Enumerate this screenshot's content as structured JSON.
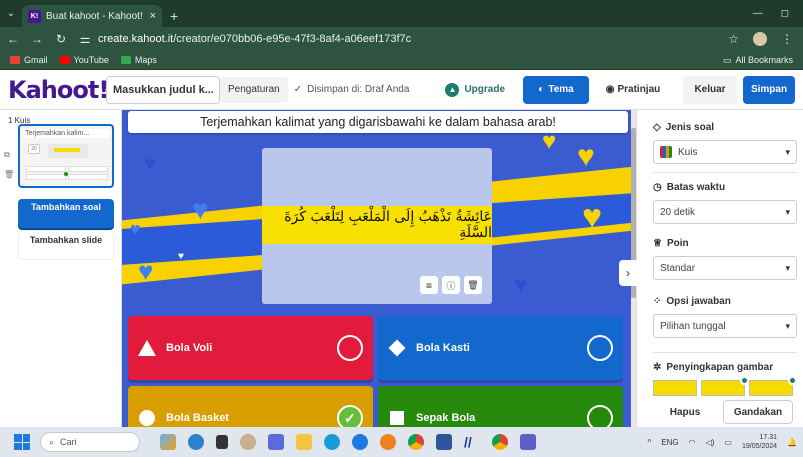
{
  "browser": {
    "tab_title": "Buat kahoot - Kahoot!",
    "tab_favicon": "K!",
    "url_host": "create.kahoot.it",
    "url_path": "/creator/e070bb06-e95e-47f3-8af4-a06eef173f7c",
    "bookmarks": [
      "Gmail",
      "YouTube",
      "Maps"
    ],
    "all_bookmarks": "All Bookmarks"
  },
  "header": {
    "logo": "Kahoot!",
    "title_placeholder": "Masukkan judul k...",
    "settings_label": "Pengaturan",
    "saved_text": "Disimpan di: Draf Anda",
    "upgrade_label": "Upgrade",
    "theme_label": "Tema",
    "preview_label": "Pratinjau",
    "exit_label": "Keluar",
    "save_label": "Simpan"
  },
  "sidebar": {
    "slide_number_label": "1 Kuis",
    "thumb_text": "Terjemahkan kalim...",
    "thumb_timer": "20",
    "add_question": "Tambahkan soal",
    "add_slide": "Tambahkan slide"
  },
  "question": {
    "text": "Terjemahkan kalimat yang digarisbawahi ke dalam bahasa arab!",
    "image_text": "عَائِشَةُ تَذْهَبُ إِلَى الْمَلْعَبِ لِتَلْعَبَ كُرَةَ السَّلَةِ"
  },
  "answers": [
    {
      "label": "Bola Voli",
      "shape": "triangle",
      "color": "#e21b3c",
      "correct": false
    },
    {
      "label": "Bola Kasti",
      "shape": "diamond",
      "color": "#1368ce",
      "correct": false
    },
    {
      "label": "Bola Basket",
      "shape": "circle",
      "color": "#d89e00",
      "correct": true
    },
    {
      "label": "Sepak Bola",
      "shape": "square",
      "color": "#26890c",
      "correct": false
    }
  ],
  "settings_panel": {
    "question_type_label": "Jenis soal",
    "question_type_value": "Kuis",
    "time_limit_label": "Batas waktu",
    "time_limit_value": "20 detik",
    "points_label": "Poin",
    "points_value": "Standar",
    "answer_options_label": "Opsi jawaban",
    "answer_options_value": "Pilihan tunggal",
    "image_reveal_label": "Penyingkapan gambar",
    "delete_label": "Hapus",
    "duplicate_label": "Gandakan"
  },
  "taskbar": {
    "search_placeholder": "Cari",
    "language": "ENG",
    "time": "17.31",
    "date": "19/05/2024"
  },
  "colors": {
    "kahoot_purple": "#46178f",
    "primary_blue": "#1368ce",
    "canvas_blue": "#3b5bd0",
    "accent_yellow": "#f8d200"
  }
}
